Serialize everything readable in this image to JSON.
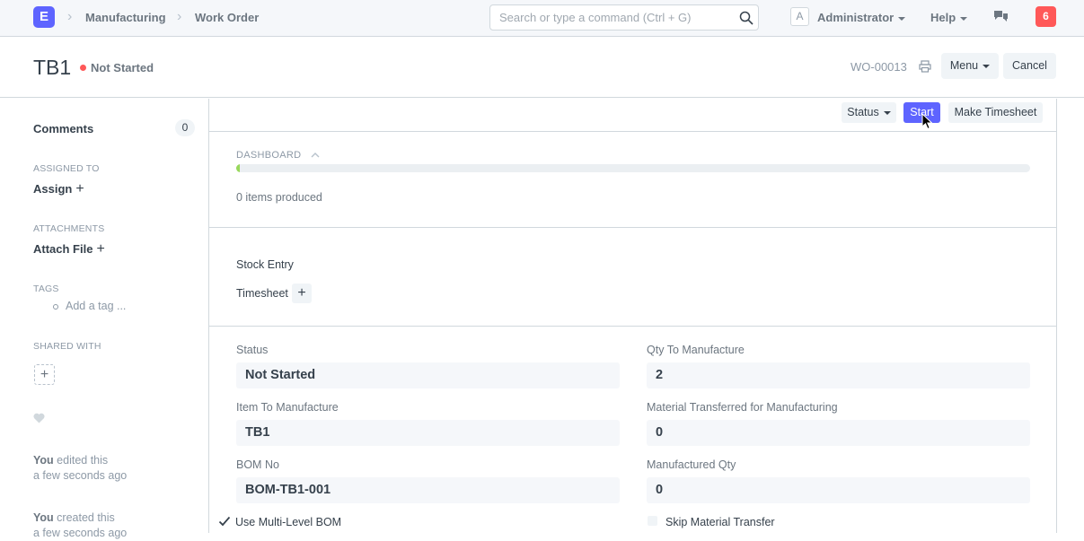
{
  "navbar": {
    "logo_letter": "E",
    "breadcrumbs": [
      "Manufacturing",
      "Work Order"
    ],
    "search_placeholder": "Search or type a command (Ctrl + G)",
    "avatar_letter": "A",
    "user": "Administrator",
    "help": "Help",
    "notification_count": "6"
  },
  "header": {
    "title": "TB1",
    "status": "Not Started",
    "doc_name": "WO-00013",
    "menu_label": "Menu",
    "cancel_label": "Cancel"
  },
  "toolbar": {
    "status_label": "Status",
    "start_label": "Start",
    "timesheet_label": "Make Timesheet"
  },
  "sidebar": {
    "comments_label": "Comments",
    "comments_count": "0",
    "assigned_to_label": "ASSIGNED TO",
    "assign_label": "Assign",
    "attachments_label": "ATTACHMENTS",
    "attach_label": "Attach File",
    "tags_label": "TAGS",
    "tag_placeholder": "Add a tag ...",
    "shared_with_label": "SHARED WITH",
    "timeline": [
      {
        "who": "You",
        "action": " edited this",
        "when": "a few seconds ago"
      },
      {
        "who": "You",
        "action": " created this",
        "when": "a few seconds ago"
      }
    ]
  },
  "dashboard": {
    "label": "DASHBOARD",
    "progress_percent": 0.5,
    "produced_text": "0 items produced"
  },
  "links": {
    "stock_entry": "Stock Entry",
    "timesheet": "Timesheet"
  },
  "fields": {
    "status": {
      "label": "Status",
      "value": "Not Started"
    },
    "qty_to_manufacture": {
      "label": "Qty To Manufacture",
      "value": "2"
    },
    "item_to_manufacture": {
      "label": "Item To Manufacture",
      "value": "TB1"
    },
    "material_transferred": {
      "label": "Material Transferred for Manufacturing",
      "value": "0"
    },
    "bom_no": {
      "label": "BOM No",
      "value": "BOM-TB1-001"
    },
    "manufactured_qty": {
      "label": "Manufactured Qty",
      "value": "0"
    },
    "use_multi_level_bom": {
      "label": "Use Multi-Level BOM",
      "checked": true
    },
    "skip_material_transfer": {
      "label": "Skip Material Transfer",
      "checked": false
    }
  },
  "colors": {
    "primary": "#5e64ff",
    "danger": "#ff5858",
    "progress": "#98d85b"
  }
}
